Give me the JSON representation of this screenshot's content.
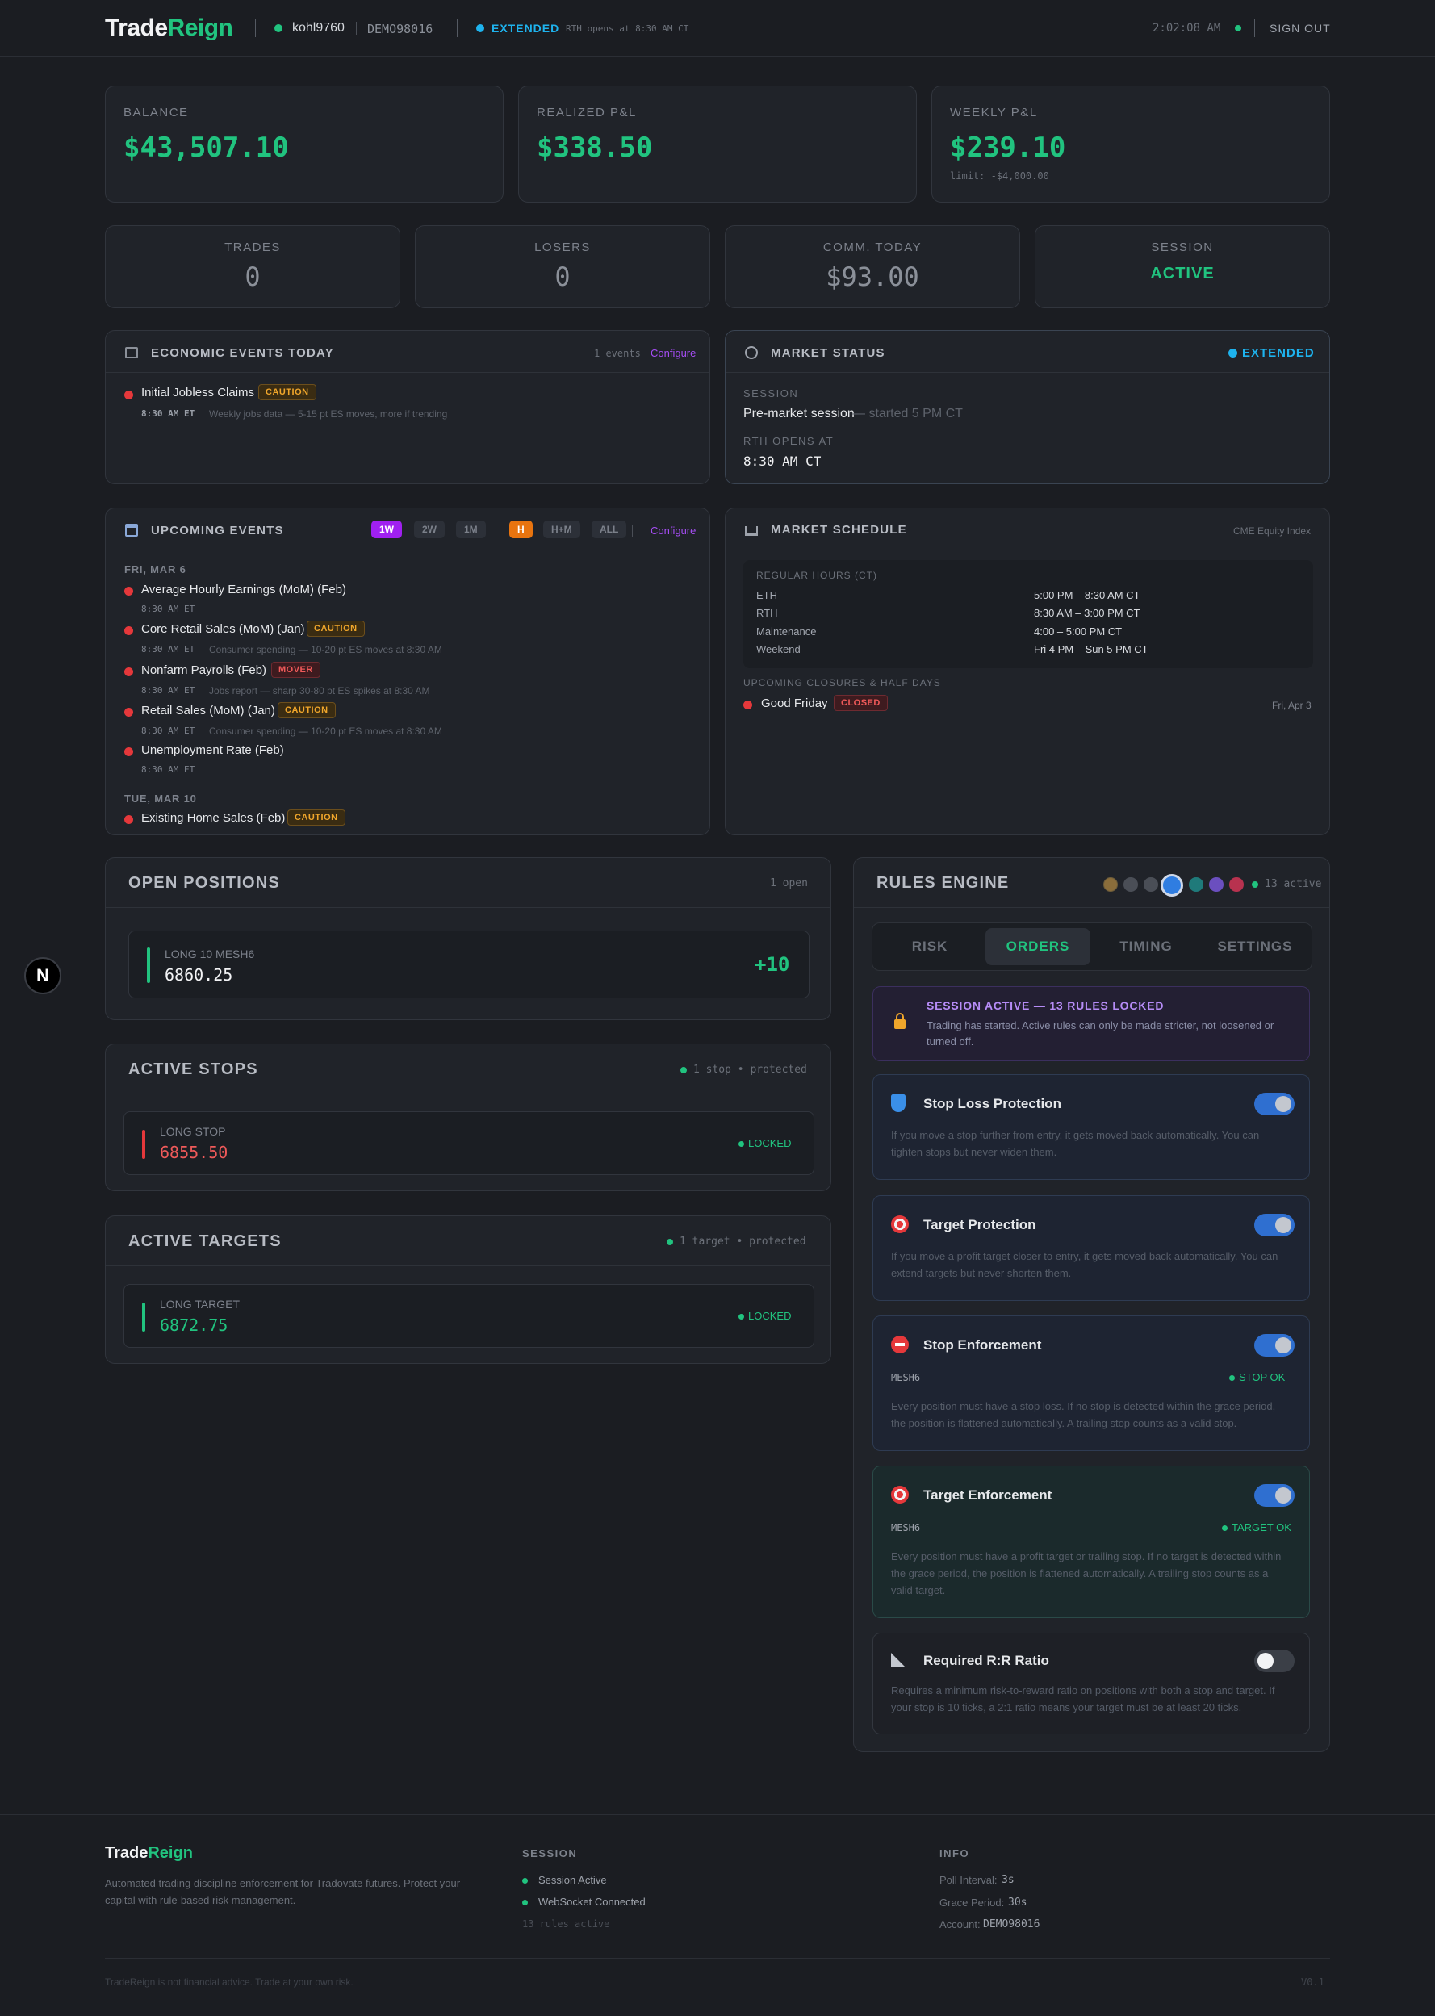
{
  "header": {
    "logo_a": "Trade",
    "logo_b": "Reign",
    "username": "kohl9760",
    "account": "DEMO98016",
    "status": "EXTENDED",
    "rth_note": "RTH opens at 8:30 AM CT",
    "clock": "2:02:08 AM",
    "sign_out": "SIGN OUT"
  },
  "stats_top": [
    {
      "label": "BALANCE",
      "value": "$43,507.10",
      "sub": ""
    },
    {
      "label": "REALIZED P&L",
      "value": "$338.50",
      "sub": ""
    },
    {
      "label": "WEEKLY P&L",
      "value": "$239.10",
      "sub": "limit: -$4,000.00"
    }
  ],
  "stats_mid": [
    {
      "label": "TRADES",
      "value": "0"
    },
    {
      "label": "LOSERS",
      "value": "0"
    },
    {
      "label": "COMM. TODAY",
      "value": "$93.00"
    },
    {
      "label": "SESSION",
      "value": "ACTIVE"
    }
  ],
  "econ": {
    "title": "ECONOMIC EVENTS TODAY",
    "count": "1 events",
    "configure": "Configure",
    "event_name": "Initial Jobless Claims",
    "event_tag": "CAUTION",
    "event_time": "8:30 AM ET",
    "event_desc": "Weekly jobs data — 5-15 pt ES moves, more if trending"
  },
  "market_status": {
    "title": "MARKET STATUS",
    "badge": "EXTENDED",
    "session_label": "SESSION",
    "session_value": "Pre-market session",
    "session_note": "— started 5 PM CT",
    "rth_label": "RTH OPENS AT",
    "rth_value": "8:30 AM CT"
  },
  "upcoming": {
    "title": "UPCOMING EVENTS",
    "filters": [
      "1W",
      "2W",
      "1M",
      "H",
      "H+M",
      "ALL"
    ],
    "configure": "Configure",
    "day1": "FRI, MAR 6",
    "day2": "TUE, MAR 10",
    "events": [
      {
        "name": "Average Hourly Earnings (MoM) (Feb)",
        "tag": "",
        "time": "8:30 AM ET",
        "desc": ""
      },
      {
        "name": "Core Retail Sales (MoM) (Jan)",
        "tag": "CAUTION",
        "time": "8:30 AM ET",
        "desc": "Consumer spending — 10-20 pt ES moves at 8:30 AM"
      },
      {
        "name": "Nonfarm Payrolls (Feb)",
        "tag": "MOVER",
        "time": "8:30 AM ET",
        "desc": "Jobs report — sharp 30-80 pt ES spikes at 8:30 AM"
      },
      {
        "name": "Retail Sales (MoM) (Jan)",
        "tag": "CAUTION",
        "time": "8:30 AM ET",
        "desc": "Consumer spending — 10-20 pt ES moves at 8:30 AM"
      },
      {
        "name": "Unemployment Rate (Feb)",
        "tag": "",
        "time": "8:30 AM ET",
        "desc": ""
      },
      {
        "name": "Existing Home Sales (Feb)",
        "tag": "CAUTION",
        "time": "",
        "desc": ""
      }
    ]
  },
  "schedule": {
    "title": "MARKET SCHEDULE",
    "index": "CME Equity Index",
    "hours_label": "REGULAR HOURS (CT)",
    "rows": [
      {
        "k": "ETH",
        "v": "5:00 PM – 8:30 AM CT"
      },
      {
        "k": "RTH",
        "v": "8:30 AM – 3:00 PM CT"
      },
      {
        "k": "Maintenance",
        "v": "4:00 – 5:00 PM CT"
      },
      {
        "k": "Weekend",
        "v": "Fri 4 PM – Sun 5 PM CT"
      }
    ],
    "closures_label": "UPCOMING CLOSURES & HALF DAYS",
    "closure_name": "Good Friday",
    "closure_tag": "CLOSED",
    "closure_date": "Fri, Apr 3"
  },
  "positions": {
    "title": "OPEN POSITIONS",
    "count": "1 open",
    "side_symbol": "LONG 10 MESH6",
    "price": "6860.25",
    "qty": "+10"
  },
  "stops": {
    "title": "ACTIVE STOPS",
    "status": "1 stop • protected",
    "label": "LONG STOP",
    "price": "6855.50",
    "lock": "LOCKED"
  },
  "targets": {
    "title": "ACTIVE TARGETS",
    "status": "1 target • protected",
    "label": "LONG TARGET",
    "price": "6872.75",
    "lock": "LOCKED"
  },
  "rules": {
    "title": "RULES ENGINE",
    "active": "13 active",
    "swatches": [
      "#8a6d3b",
      "#4a4e56",
      "#4a4e56",
      "#2f7de1",
      "#1f7a7a",
      "#6b4fbf",
      "#b8324f"
    ],
    "tabs": [
      "RISK",
      "ORDERS",
      "TIMING",
      "SETTINGS"
    ],
    "lock_title": "SESSION ACTIVE — 13 RULES LOCKED",
    "lock_desc": "Trading has started. Active rules can only be made stricter, not loosened or turned off.",
    "items": [
      {
        "title": "Stop Loss Protection",
        "symbol": "",
        "status": "",
        "desc": "If you move a stop further from entry, it gets moved back automatically. You can tighten stops but never widen them.",
        "on": true
      },
      {
        "title": "Target Protection",
        "symbol": "",
        "status": "",
        "desc": "If you move a profit target closer to entry, it gets moved back automatically. You can extend targets but never shorten them.",
        "on": true
      },
      {
        "title": "Stop Enforcement",
        "symbol": "MESH6",
        "status": "STOP OK",
        "desc": "Every position must have a stop loss. If no stop is detected within the grace period, the position is flattened automatically. A trailing stop counts as a valid stop.",
        "on": true
      },
      {
        "title": "Target Enforcement",
        "symbol": "MESH6",
        "status": "TARGET OK",
        "desc": "Every position must have a profit target or trailing stop. If no target is detected within the grace period, the position is flattened automatically. A trailing stop counts as a valid target.",
        "on": true
      },
      {
        "title": "Required R:R Ratio",
        "symbol": "",
        "status": "",
        "desc": "Requires a minimum risk-to-reward ratio on positions with both a stop and target. If your stop is 10 ticks, a 2:1 ratio means your target must be at least 20 ticks.",
        "on": false
      }
    ]
  },
  "footer": {
    "logo_a": "Trade",
    "logo_b": "Reign",
    "tagline": "Automated trading discipline enforcement for Tradovate futures. Protect your capital with rule-based risk management.",
    "session_title": "SESSION",
    "session_items": [
      "Session Active",
      "WebSocket Connected",
      "13 rules active"
    ],
    "info_title": "INFO",
    "poll_label": "Poll Interval:",
    "poll_value": "3s",
    "grace_label": "Grace Period:",
    "grace_value": "30s",
    "account_label": "Account:",
    "account_value": "DEMO98016",
    "disclaimer": "TradeReign is not financial advice. Trade at your own risk.",
    "version": "V0.1"
  },
  "colors": {
    "accent": "#21c37f",
    "extended": "#1eb3ee",
    "purple": "#a64df5",
    "danger": "#e5383b",
    "orange": "#e8740f"
  }
}
